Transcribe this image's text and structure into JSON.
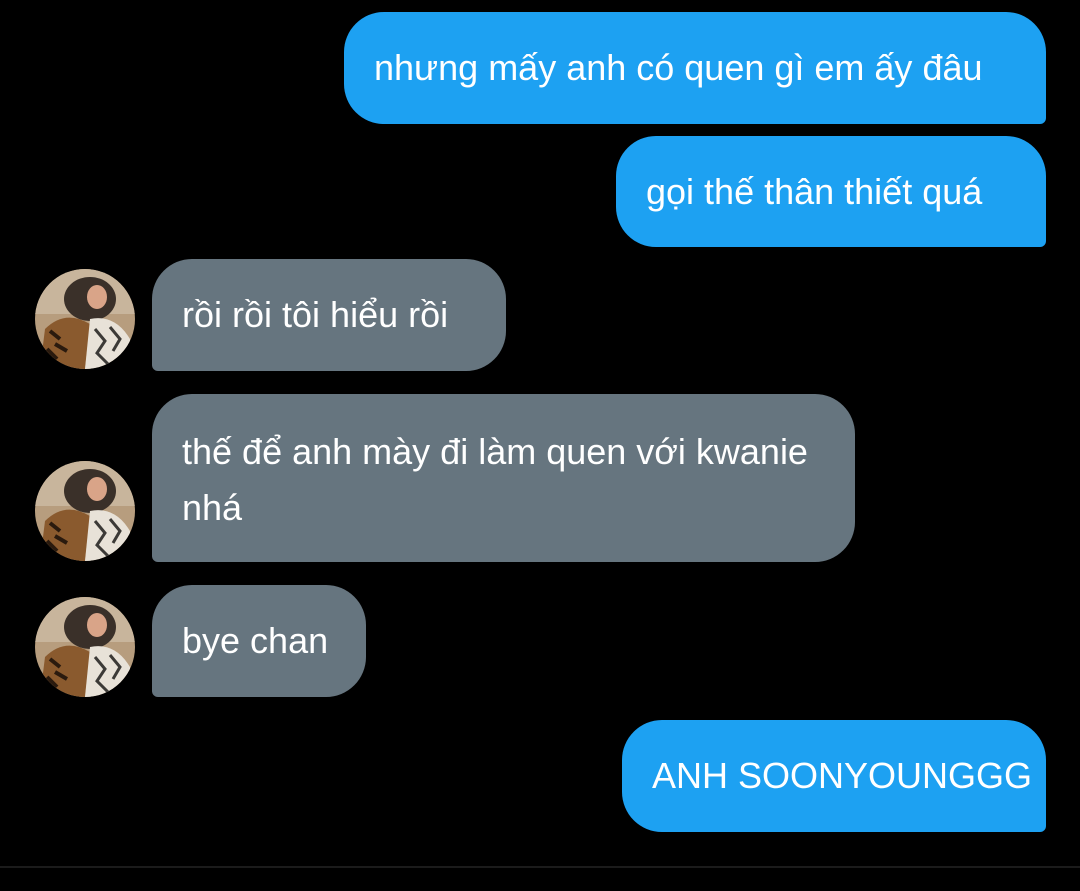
{
  "colors": {
    "background": "#000000",
    "sent_bubble": "#1da1f2",
    "received_bubble": "#66757f",
    "text": "#ffffff"
  },
  "messages": [
    {
      "side": "sent",
      "text": "nhưng mấy anh có quen gì em ấy đâu"
    },
    {
      "side": "sent",
      "text": "gọi thế thân thiết quá"
    },
    {
      "side": "received",
      "text": "rồi rồi tôi hiểu rồi"
    },
    {
      "side": "received",
      "text": "thế để anh mày đi làm quen với kwanie nhá"
    },
    {
      "side": "received",
      "text": "bye chan"
    },
    {
      "side": "sent",
      "text": "ANH SOONYOUNGGG"
    }
  ],
  "icons": {
    "avatar": "user-avatar-photo-icon"
  }
}
